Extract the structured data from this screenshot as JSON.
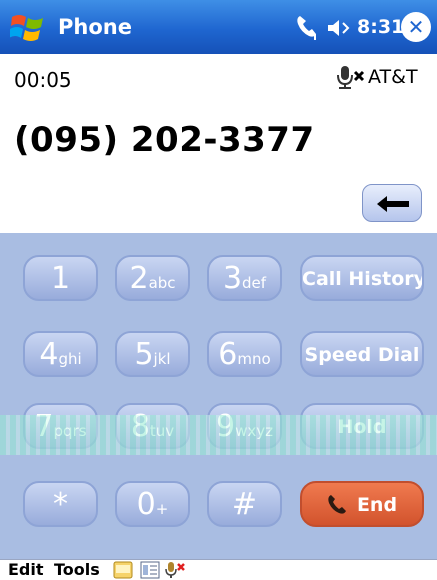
{
  "titlebar": {
    "title": "Phone",
    "time": "8:31",
    "close_glyph": "✕",
    "icons": [
      "windows-start-icon",
      "signal-icon",
      "speaker-icon",
      "close-icon"
    ]
  },
  "call": {
    "elapsed": "00:05",
    "carrier": "AT&T",
    "number": "(095) 202-3377",
    "mute_icon": "microphone-muted-icon"
  },
  "backspace": {
    "icon": "back-arrow-icon"
  },
  "keypad": {
    "keys": [
      {
        "digit": "1",
        "letters": ""
      },
      {
        "digit": "2",
        "letters": "abc"
      },
      {
        "digit": "3",
        "letters": "def"
      },
      {
        "digit": "4",
        "letters": "ghi"
      },
      {
        "digit": "5",
        "letters": "jkl"
      },
      {
        "digit": "6",
        "letters": "mno"
      },
      {
        "digit": "7",
        "letters": "pqrs"
      },
      {
        "digit": "8",
        "letters": "tuv"
      },
      {
        "digit": "9",
        "letters": "wxyz"
      },
      {
        "digit": "*",
        "letters": ""
      },
      {
        "digit": "0",
        "letters": "+"
      },
      {
        "digit": "#",
        "letters": ""
      }
    ],
    "call_history": "Call History",
    "speed_dial": "Speed Dial",
    "hold": "Hold",
    "end": "End"
  },
  "menu": {
    "edit": "Edit",
    "tools": "Tools"
  },
  "colors": {
    "titlebar": "#1f66d0",
    "keypad_bg": "#a9bde2",
    "end_button": "#e06a3e"
  }
}
